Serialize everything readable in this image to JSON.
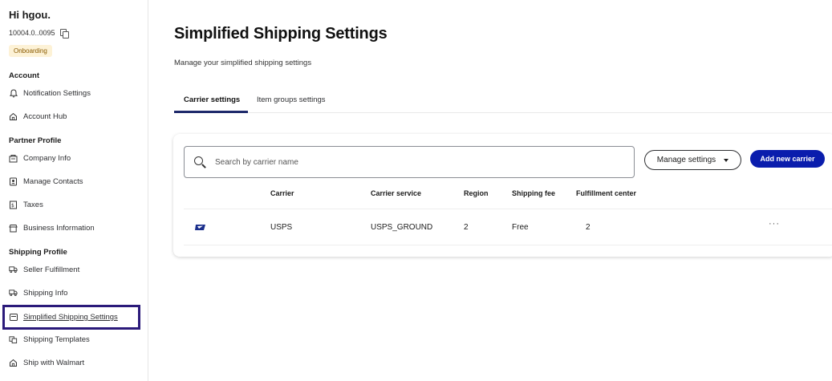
{
  "sidebar": {
    "user_name": "Hi hgou.",
    "user_id": "10004.0..0095",
    "badge": "Onboarding",
    "sections": {
      "account": "Account",
      "partner_profile": "Partner Profile",
      "shipping_profile": "Shipping Profile"
    },
    "items": [
      {
        "label": "Notification Settings",
        "icon": "bell-icon"
      },
      {
        "label": "Account Hub",
        "icon": "home-icon"
      },
      {
        "label": "Company Info",
        "icon": "building-icon"
      },
      {
        "label": "Manage Contacts",
        "icon": "contact-icon"
      },
      {
        "label": "Taxes",
        "icon": "tax-icon"
      },
      {
        "label": "Business Information",
        "icon": "store-icon"
      },
      {
        "label": "Seller Fulfillment",
        "icon": "truck-icon"
      },
      {
        "label": "Shipping Info",
        "icon": "truck-icon"
      },
      {
        "label": "Simplified Shipping Settings",
        "icon": "window-icon"
      },
      {
        "label": "Shipping Templates",
        "icon": "template-icon"
      },
      {
        "label": "Ship with Walmart",
        "icon": "home-icon"
      }
    ]
  },
  "main": {
    "title": "Simplified Shipping Settings",
    "subtitle": "Manage your simplified shipping settings",
    "tabs": [
      {
        "label": "Carrier settings",
        "active": true
      },
      {
        "label": "Item groups settings",
        "active": false
      }
    ],
    "search": {
      "placeholder": "Search by carrier name",
      "value": ""
    },
    "manage_button": "Manage settings",
    "add_button": "Add new carrier",
    "table": {
      "headers": [
        "Carrier",
        "Carrier service",
        "Region",
        "Shipping fee",
        "Fulfillment center"
      ],
      "rows": [
        {
          "carrier": "USPS",
          "service": "USPS_GROUND",
          "region": "2",
          "fee": "Free",
          "fc": "2",
          "more": "···"
        }
      ]
    }
  },
  "colors": {
    "accent": "#0a1dad",
    "active_tab_underline": "#1f2a6b",
    "active_nav_border": "#2b1a7a",
    "badge_bg": "#fdf2d6",
    "badge_text": "#8a5a00"
  }
}
